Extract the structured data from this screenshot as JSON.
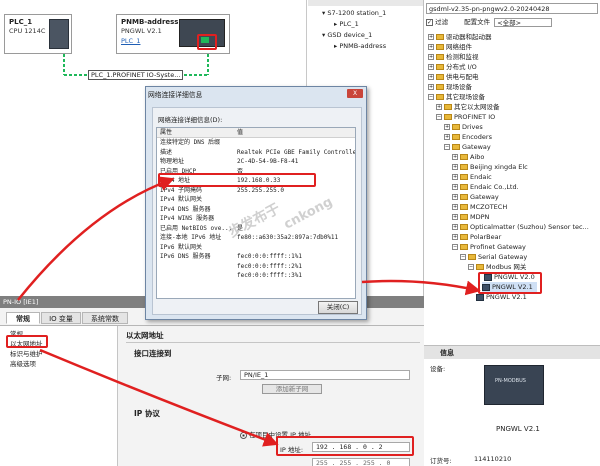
{
  "network_view": {
    "plc": {
      "name": "PLC_1",
      "model": "CPU 1214C"
    },
    "device": {
      "name": "PNMB-address",
      "model": "PNGWL V2.1",
      "link": "PLC_1"
    },
    "network_label": "PLC_1.PROFINET IO-Syste..."
  },
  "tree": {
    "items": [
      "S7-1200 station_1",
      "PLC_1",
      "GSD device_1",
      "PNMB-address"
    ]
  },
  "catalog": {
    "file_title": "gsdml-v2.35-pn-pngwv2.0-20240428",
    "filter_label": "过滤",
    "profile_label": "配置文件",
    "profile_value": "<全部>",
    "items": [
      "驱动器和起动器",
      "网络组件",
      "检测和监视",
      "分布式 I/O",
      "供电与配电",
      "现场设备",
      "其它现场设备",
      "其它以太网设备",
      "PROFINET IO",
      "Drives",
      "Encoders",
      "Gateway",
      "Aibo",
      "Beijing xingda Elc",
      "Endaic",
      "Endaic Co.,Ltd.",
      "Gateway",
      "MCZOTECH",
      "MDPN",
      "Opticalmatter (Suzhou) Sensor tec...",
      "PolarBear",
      "Profinet Gateway",
      "Serial Gateway",
      "Modbus 网关",
      "PNGWL V2.0",
      "PNGWL V2.1",
      "PNGWL V2.1"
    ]
  },
  "dialog": {
    "title": "网络连接详细信息",
    "close_glyph": "X",
    "caption": "网络连接详细信息(D):",
    "col_property": "属性",
    "col_value": "值",
    "ok_label": "关闭(C)",
    "rows": [
      {
        "k": "连接特定的 DNS 后缀",
        "v": ""
      },
      {
        "k": "描述",
        "v": "Realtek PCIe GBE Family Controlle"
      },
      {
        "k": "物理地址",
        "v": "2C-4D-54-9B-F8-41"
      },
      {
        "k": "已启用 DHCP",
        "v": "否"
      },
      {
        "k": "IPv4 地址",
        "v": "192.168.0.33"
      },
      {
        "k": "IPv4 子网掩码",
        "v": "255.255.255.0"
      },
      {
        "k": "IPv4 默认网关",
        "v": ""
      },
      {
        "k": "IPv4 DNS 服务器",
        "v": ""
      },
      {
        "k": "IPv4 WINS 服务器",
        "v": ""
      },
      {
        "k": "已启用 NetBIOS ove...",
        "v": "是"
      },
      {
        "k": "连接-本地 IPv6 地址",
        "v": "fe80::a630:35a2:897a:7db0%11"
      },
      {
        "k": "IPv6 默认网关",
        "v": ""
      },
      {
        "k": "IPv6 DNS 服务器",
        "v": "fec0:0:0:ffff::1%1"
      },
      {
        "k": "",
        "v": "fec0:0:0:ffff::2%1"
      },
      {
        "k": "",
        "v": "fec0:0:0:ffff::3%1"
      }
    ]
  },
  "props": {
    "header": "PN-IO [IE1]",
    "tabs": [
      "常规",
      "IO 变量",
      "系统常数"
    ],
    "nav": [
      "常规",
      "以太网地址",
      "标识与维护",
      "高级选项"
    ],
    "section_ethernet": "以太网地址",
    "section_interface": "接口连接到",
    "subnet_label": "子网:",
    "subnet_value": "PN/IE_1",
    "add_subnet_label": "添加新子网",
    "section_ip": "IP 协议",
    "ip_option": "在项目中设置 IP 地址",
    "ip_label": "IP 地址:",
    "ip": [
      "192",
      "168",
      "0",
      "2"
    ],
    "mask": [
      "255",
      "255",
      "255",
      "0"
    ]
  },
  "info": {
    "title": "信息",
    "device_label": "设备:",
    "device_image_text": "PN-MODBUS",
    "device_name": "PNGWL V2.1",
    "order_label": "订货号:",
    "order_value": "114110210"
  },
  "watermark": {
    "cn": "步发布于",
    "en": "cnkong"
  },
  "colors": {
    "accent_red": "#e02020",
    "network_green": "#1fb85a",
    "siemens_teal": "#0b8a8a"
  }
}
